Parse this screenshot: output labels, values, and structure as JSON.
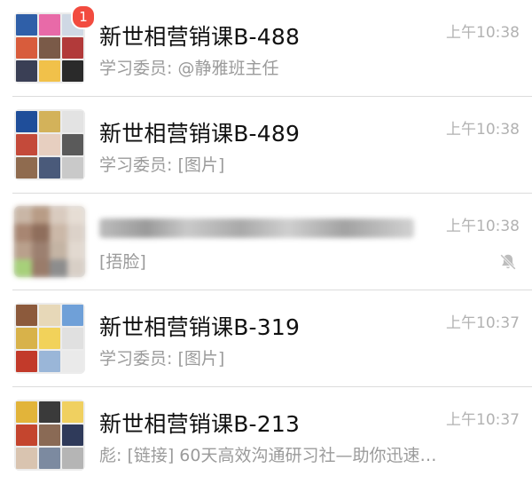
{
  "chats": [
    {
      "title": "新世相营销课B-488",
      "preview": "学习委员: @静雅班主任",
      "time": "上午10:38",
      "badge": "1",
      "muted": false,
      "blurred": false,
      "avatar_colors": [
        "#2f5fa8",
        "#e86aa8",
        "#cfd8e4",
        "#d85c3c",
        "#7a5a48",
        "#b23a3a",
        "#3a3f55",
        "#f1c14a",
        "#2a2a2a"
      ]
    },
    {
      "title": "新世相营销课B-489",
      "preview": "学习委员: [图片]",
      "time": "上午10:38",
      "badge": "",
      "muted": false,
      "blurred": false,
      "avatar_colors": [
        "#1f4e9a",
        "#d3b25a",
        "#e3e3e3",
        "#c44a3a",
        "#e7cfc0",
        "#5a5a5a",
        "#8f6b4f",
        "#4a5a7a",
        "#c9c9c9"
      ]
    },
    {
      "title": "",
      "preview": "[捂脸]",
      "time": "上午10:38",
      "badge": "",
      "muted": true,
      "blurred": true,
      "avatar_colors": [
        "#c9b6a6",
        "#b89c86",
        "#d9cbbf",
        "#e6ddd4",
        "#a88672",
        "#8f6e5c",
        "#cbb8a8",
        "#dcd2c9",
        "#b9a08c",
        "#9c8070",
        "#c4b4a4",
        "#e2d9d0",
        "#a7d07a",
        "#9a7c6a",
        "#8d8d8d",
        "#d8cfc6"
      ]
    },
    {
      "title": "新世相营销课B-319",
      "preview": "学习委员: [图片]",
      "time": "上午10:37",
      "badge": "",
      "muted": false,
      "blurred": false,
      "avatar_colors": [
        "#8c5a3c",
        "#e7d8b8",
        "#6fa0d8",
        "#d8b24a",
        "#f2d25a",
        "#e0e0e0",
        "#c23a2a",
        "#9ab6d8",
        "#eaeaea"
      ]
    },
    {
      "title": "新世相营销课B-213",
      "preview": "彪: [链接] 60天高效沟通研习社—助你迅速…",
      "time": "上午10:37",
      "badge": "",
      "muted": false,
      "blurred": false,
      "avatar_colors": [
        "#e2b43a",
        "#3a3a3a",
        "#f0d060",
        "#c4452e",
        "#8a6a55",
        "#2f3a5a",
        "#d9c4b0",
        "#7c8aa0",
        "#b5b5b5"
      ]
    }
  ],
  "icons": {
    "mute": "bell-slash-icon"
  }
}
